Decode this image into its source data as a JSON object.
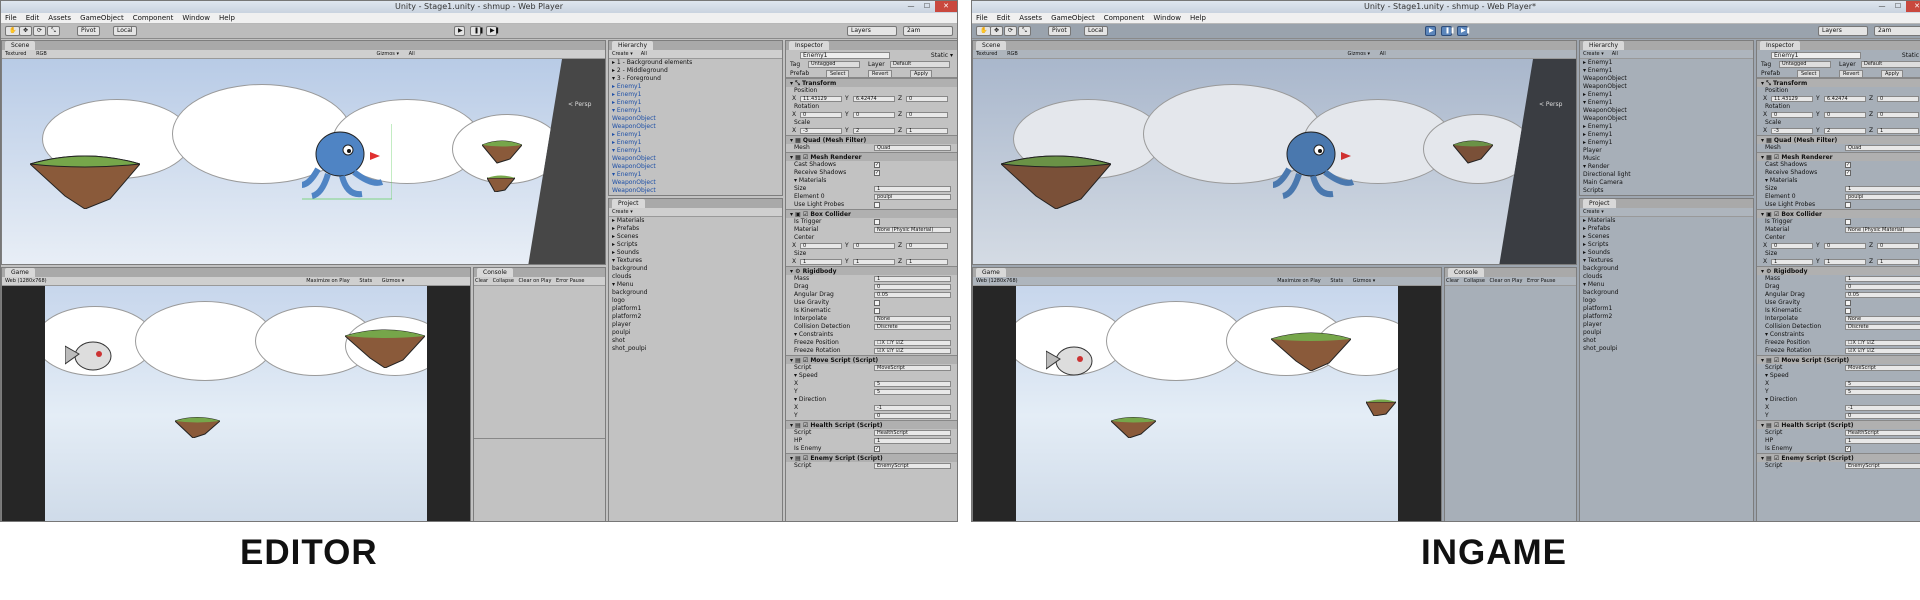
{
  "editor": {
    "title": "Unity - Stage1.unity - shmup - Web Player",
    "caption": "EDITOR"
  },
  "ingame": {
    "title": "Unity - Stage1.unity - shmup - Web Player*",
    "caption": "INGAME"
  },
  "menu": [
    "File",
    "Edit",
    "Assets",
    "GameObject",
    "Component",
    "Window",
    "Help"
  ],
  "toolbar": {
    "pivot": "Pivot",
    "local": "Local",
    "layers": "Layers",
    "layout": "2am",
    "play": "▶",
    "pause": "❚❚",
    "step": "▶❚"
  },
  "scene": {
    "tab": "Scene",
    "shading": "Textured",
    "render": "RGB",
    "gizmos": "Gizmos ▾",
    "search": "All",
    "persp": "< Persp"
  },
  "game": {
    "tab": "Game",
    "aspect": "Web (1280x768)",
    "maximize": "Maximize on Play",
    "stats": "Stats",
    "gizmos": "Gizmos ▾"
  },
  "console": {
    "tab": "Console",
    "clear": "Clear",
    "collapse": "Collapse",
    "clear_on_play": "Clear on Play",
    "error_pause": "Error Pause"
  },
  "hierarchy": {
    "tab": "Hierarchy",
    "create": "Create ▾",
    "search": "All",
    "editor_items": [
      {
        "label": "▸ 1 - Background elements",
        "blue": false
      },
      {
        "label": "▸ 2 - Middleground",
        "blue": false
      },
      {
        "label": "▾ 3 - Foreground",
        "blue": false
      },
      {
        "label": "   ▸ Enemy1",
        "blue": true
      },
      {
        "label": "   ▸ Enemy1",
        "blue": true
      },
      {
        "label": "   ▸ Enemy1",
        "blue": true
      },
      {
        "label": "   ▾ Enemy1",
        "blue": true
      },
      {
        "label": "        WeaponObject",
        "blue": true
      },
      {
        "label": "        WeaponObject",
        "blue": true
      },
      {
        "label": "   ▸ Enemy1",
        "blue": true
      },
      {
        "label": "   ▸ Enemy1",
        "blue": true
      },
      {
        "label": "   ▾ Enemy1",
        "blue": true
      },
      {
        "label": "        WeaponObject",
        "blue": true
      },
      {
        "label": "        WeaponObject",
        "blue": true
      },
      {
        "label": "   ▾ Enemy1",
        "blue": true
      },
      {
        "label": "        WeaponObject",
        "blue": true
      },
      {
        "label": "        WeaponObject",
        "blue": true
      }
    ],
    "ingame_items": [
      {
        "label": "   ▸ Enemy1",
        "blue": false
      },
      {
        "label": "   ▾ Enemy1",
        "blue": false
      },
      {
        "label": "        WeaponObject",
        "blue": false
      },
      {
        "label": "        WeaponObject",
        "blue": false
      },
      {
        "label": "   ▸ Enemy1",
        "blue": false
      },
      {
        "label": "   ▾ Enemy1",
        "blue": false
      },
      {
        "label": "        WeaponObject",
        "blue": false
      },
      {
        "label": "        WeaponObject",
        "blue": false
      },
      {
        "label": "   ▸ Enemy1",
        "blue": false
      },
      {
        "label": "   ▸ Enemy1",
        "blue": false
      },
      {
        "label": "   ▸ Enemy1",
        "blue": false
      },
      {
        "label": "     Player",
        "blue": false
      },
      {
        "label": "     Music",
        "blue": false
      },
      {
        "label": "▾ Render",
        "blue": false
      },
      {
        "label": "     Directional light",
        "blue": false
      },
      {
        "label": "     Main Camera",
        "blue": false
      },
      {
        "label": "   Scripts",
        "blue": false
      }
    ]
  },
  "project": {
    "tab": "Project",
    "create": "Create ▾",
    "items": [
      "▸ Materials",
      "▸ Prefabs",
      "▸ Scenes",
      "▸ Scripts",
      "▸ Sounds",
      "▾ Textures",
      "     background",
      "     clouds",
      "   ▾ Menu",
      "        background",
      "        logo",
      "     platform1",
      "     platform2",
      "     player",
      "     poulpi",
      "     shot",
      "     shot_poulpi"
    ]
  },
  "inspector": {
    "tab": "Inspector",
    "object_name": "Enemy1",
    "static": "Static ▾",
    "tag_label": "Tag",
    "tag": "Untagged",
    "layer_label": "Layer",
    "layer": "Default",
    "prefab_label": "Prefab",
    "select": "Select",
    "revert": "Revert",
    "apply": "Apply",
    "rows": [
      {
        "kind": "comp",
        "label": "▾ ⤡ Transform"
      },
      {
        "kind": "sub",
        "label": "Position"
      },
      {
        "kind": "xyz",
        "x": "11.43129",
        "y": "6.42474",
        "z": "0"
      },
      {
        "kind": "sub",
        "label": "Rotation"
      },
      {
        "kind": "xyz",
        "x": "0",
        "y": "0",
        "z": "0"
      },
      {
        "kind": "sub",
        "label": "Scale"
      },
      {
        "kind": "xyz",
        "x": "-3",
        "y": "2",
        "z": "1"
      },
      {
        "kind": "comp",
        "label": "▾ ▦ Quad (Mesh Filter)"
      },
      {
        "kind": "val",
        "label": "Mesh",
        "value": "Quad"
      },
      {
        "kind": "comp",
        "label": "▾ ▦ ☑ Mesh Renderer"
      },
      {
        "kind": "chk",
        "label": "Cast Shadows",
        "value": "✓"
      },
      {
        "kind": "chk",
        "label": "Receive Shadows",
        "value": "✓"
      },
      {
        "kind": "sub",
        "label": "▾ Materials"
      },
      {
        "kind": "val",
        "label": "   Size",
        "value": "1"
      },
      {
        "kind": "val",
        "label": "   Element 0",
        "value": "poulpi"
      },
      {
        "kind": "chk",
        "label": "Use Light Probes",
        "value": ""
      },
      {
        "kind": "comp",
        "label": "▾ ▣ ☑ Box Collider"
      },
      {
        "kind": "chk",
        "label": "Is Trigger",
        "value": ""
      },
      {
        "kind": "val",
        "label": "Material",
        "value": "None (Physic Material)"
      },
      {
        "kind": "sub",
        "label": "Center"
      },
      {
        "kind": "xyz",
        "x": "0",
        "y": "0",
        "z": "0"
      },
      {
        "kind": "sub",
        "label": "Size"
      },
      {
        "kind": "xyz",
        "x": "1",
        "y": "1",
        "z": "1"
      },
      {
        "kind": "comp",
        "label": "▾ ⚙ Rigidbody"
      },
      {
        "kind": "val",
        "label": "Mass",
        "value": "1"
      },
      {
        "kind": "val",
        "label": "Drag",
        "value": "0"
      },
      {
        "kind": "val",
        "label": "Angular Drag",
        "value": "0.05"
      },
      {
        "kind": "chk",
        "label": "Use Gravity",
        "value": ""
      },
      {
        "kind": "chk",
        "label": "Is Kinematic",
        "value": ""
      },
      {
        "kind": "val",
        "label": "Interpolate",
        "value": "None"
      },
      {
        "kind": "val",
        "label": "Collision Detection",
        "value": "Discrete"
      },
      {
        "kind": "sub",
        "label": "▾ Constraints"
      },
      {
        "kind": "val",
        "label": "   Freeze Position",
        "value": "☐X ☐Y ☑Z"
      },
      {
        "kind": "val",
        "label": "   Freeze Rotation",
        "value": "☑X ☑Y ☑Z"
      },
      {
        "kind": "comp",
        "label": "▾ ▤ ☑ Move Script (Script)"
      },
      {
        "kind": "val",
        "label": "Script",
        "value": "MoveScript"
      },
      {
        "kind": "sub",
        "label": "▾ Speed"
      },
      {
        "kind": "val",
        "label": "   X",
        "value": "5"
      },
      {
        "kind": "val",
        "label": "   Y",
        "value": "5"
      },
      {
        "kind": "sub",
        "label": "▾ Direction"
      },
      {
        "kind": "val",
        "label": "   X",
        "value": "-1"
      },
      {
        "kind": "val",
        "label": "   Y",
        "value": "0"
      },
      {
        "kind": "comp",
        "label": "▾ ▤ ☑ Health Script (Script)"
      },
      {
        "kind": "val",
        "label": "Script",
        "value": "HealthScript"
      },
      {
        "kind": "val",
        "label": "HP",
        "value": "1"
      },
      {
        "kind": "chk",
        "label": "Is Enemy",
        "value": "✓"
      },
      {
        "kind": "comp",
        "label": "▾ ▤ ☑ Enemy Script (Script)"
      },
      {
        "kind": "val",
        "label": "Script",
        "value": "EnemyScript"
      }
    ]
  },
  "colors": {
    "sky_top": "#c7d6ec",
    "sky_bottom": "#cfdbe9",
    "grass": "#76a64a",
    "rock": "#8a5a3a",
    "octopus": "#4f84c4",
    "play_active": "#5c86bb"
  }
}
